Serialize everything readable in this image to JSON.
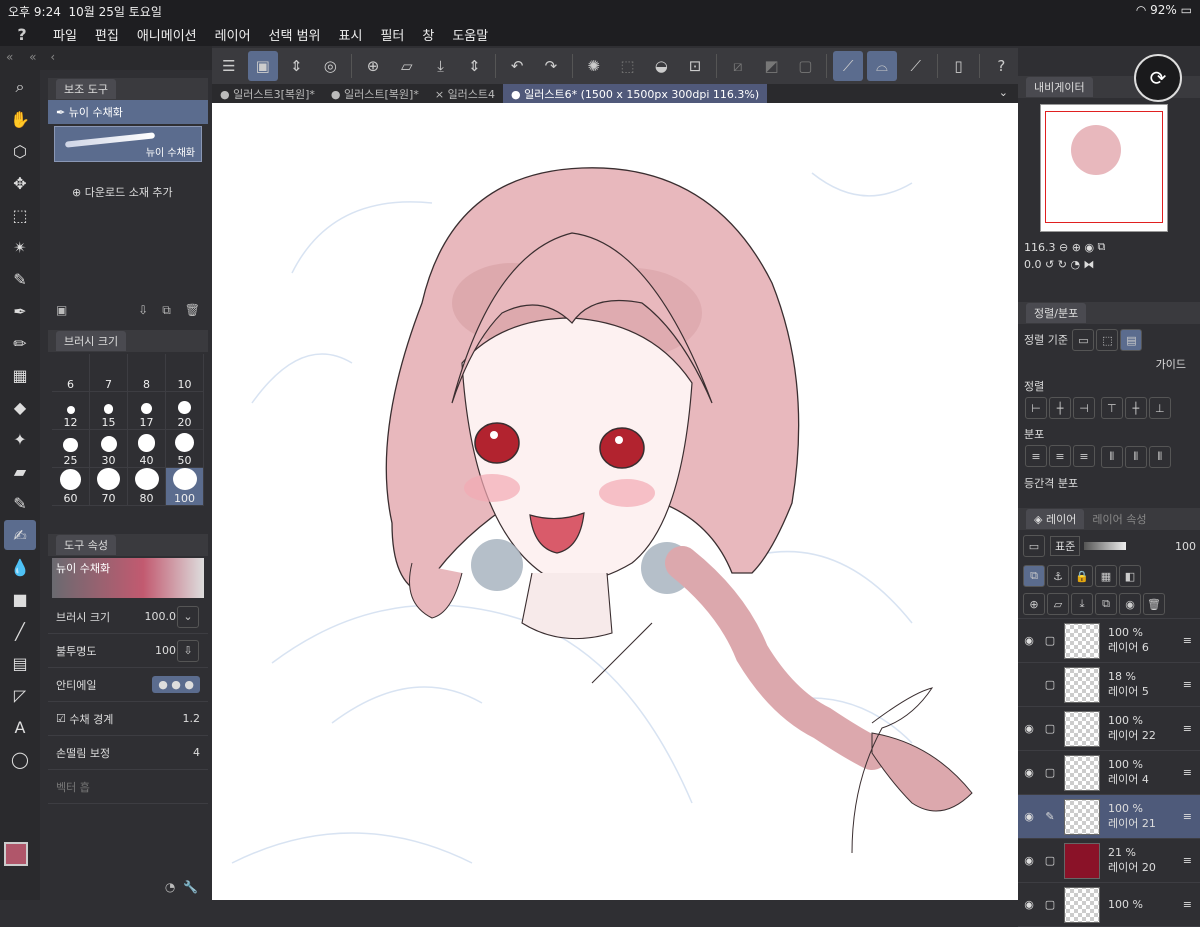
{
  "status": {
    "time": "오후 9:24",
    "date": "10월 25일 토요일",
    "battery": "92%"
  },
  "menu": {
    "items": [
      "파일",
      "편집",
      "애니메이션",
      "레이어",
      "선택 범위",
      "표시",
      "필터",
      "창",
      "도움말"
    ]
  },
  "tabs": [
    {
      "label": "일러스트3[복원]*"
    },
    {
      "label": "일러스트[복원]*"
    },
    {
      "label": "일러스트4"
    },
    {
      "label": "일러스트6* (1500 x 1500px 300dpi 116.3%)"
    }
  ],
  "subtool": {
    "header": "보조 도구",
    "item": "뉴이 수채화",
    "preview_label": "뉴이 수채화",
    "add_label": "다운로드 소재 추가"
  },
  "brushsize": {
    "header": "브러시 크기",
    "sizes": [
      "6",
      "7",
      "8",
      "10",
      "12",
      "15",
      "17",
      "20",
      "25",
      "30",
      "40",
      "50",
      "60",
      "70",
      "80",
      "100"
    ]
  },
  "toolprop": {
    "header": "도구 속성",
    "brush_name": "뉴이 수채화",
    "size_label": "브러시 크기",
    "size_value": "100.0",
    "opacity_label": "불투명도",
    "opacity_value": "100",
    "aa_label": "안티에일",
    "edge_label": "수채 경계",
    "edge_value": "1.2",
    "stab_label": "손떨림 보정",
    "stab_value": "4",
    "vector_label": "벡터 흡"
  },
  "navigator": {
    "header": "내비게이터",
    "zoom": "116.3",
    "angle": "0.0"
  },
  "align": {
    "header": "정렬/분포",
    "base_label": "정렬 기준",
    "guide_label": "가이드",
    "align_label": "정렬",
    "distribute_label": "분포",
    "equal_label": "등간격 분포"
  },
  "layers": {
    "header": "레이어",
    "header2": "레이어 속성",
    "blend": "표준",
    "opacity": "100",
    "items": [
      {
        "pct": "100 %",
        "name": "레이어 6"
      },
      {
        "pct": "18 %",
        "name": "레이어 5"
      },
      {
        "pct": "100 %",
        "name": "레이어 22"
      },
      {
        "pct": "100 %",
        "name": "레이어 4"
      },
      {
        "pct": "100 %",
        "name": "레이어 21"
      },
      {
        "pct": "21 %",
        "name": "레이어 20"
      },
      {
        "pct": "100 %",
        "name": ""
      }
    ]
  },
  "colors": {
    "accent": "#5b6c8e",
    "main_color": "#b0566a",
    "layer20_fill": "#8a1228"
  }
}
